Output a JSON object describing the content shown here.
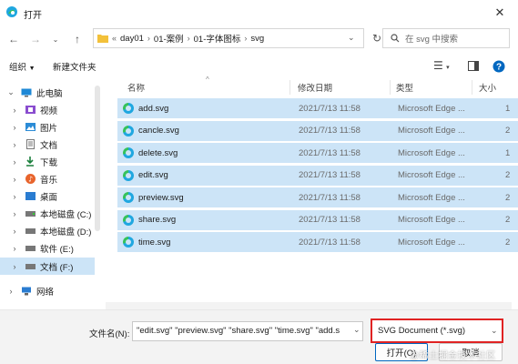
{
  "window": {
    "title": "打开"
  },
  "nav": {
    "breadcrumb": [
      "day01",
      "01-案例",
      "01-字体图标",
      "svg"
    ],
    "breadcrumb_prefix": "«",
    "search_placeholder": "在 svg 中搜索"
  },
  "toolbar": {
    "organize": "组织",
    "new_folder": "新建文件夹"
  },
  "sidebar": {
    "items": [
      {
        "label": "此电脑",
        "icon": "computer-icon",
        "expanded": true
      },
      {
        "label": "视频",
        "icon": "video-icon"
      },
      {
        "label": "图片",
        "icon": "picture-icon"
      },
      {
        "label": "文档",
        "icon": "document-icon"
      },
      {
        "label": "下载",
        "icon": "download-icon"
      },
      {
        "label": "音乐",
        "icon": "music-icon"
      },
      {
        "label": "桌面",
        "icon": "desktop-icon"
      },
      {
        "label": "本地磁盘 (C:)",
        "icon": "drive-icon"
      },
      {
        "label": "本地磁盘 (D:)",
        "icon": "drive-icon"
      },
      {
        "label": "软件 (E:)",
        "icon": "drive-icon"
      },
      {
        "label": "文档 (F:)",
        "icon": "drive-icon",
        "selected": true
      },
      {
        "label": "网络",
        "icon": "network-icon"
      }
    ]
  },
  "columns": {
    "name": "名称",
    "date": "修改日期",
    "type": "类型",
    "size": "大小"
  },
  "files": [
    {
      "name": "add.svg",
      "date": "2021/7/13 11:58",
      "type": "Microsoft Edge ...",
      "size": "1"
    },
    {
      "name": "cancle.svg",
      "date": "2021/7/13 11:58",
      "type": "Microsoft Edge ...",
      "size": "2"
    },
    {
      "name": "delete.svg",
      "date": "2021/7/13 11:58",
      "type": "Microsoft Edge ...",
      "size": "1"
    },
    {
      "name": "edit.svg",
      "date": "2021/7/13 11:58",
      "type": "Microsoft Edge ...",
      "size": "2"
    },
    {
      "name": "preview.svg",
      "date": "2021/7/13 11:58",
      "type": "Microsoft Edge ...",
      "size": "2"
    },
    {
      "name": "share.svg",
      "date": "2021/7/13 11:58",
      "type": "Microsoft Edge ...",
      "size": "2"
    },
    {
      "name": "time.svg",
      "date": "2021/7/13 11:58",
      "type": "Microsoft Edge ...",
      "size": "2"
    }
  ],
  "bottom": {
    "filename_label": "文件名(N):",
    "filename_value": "\"edit.svg\" \"preview.svg\" \"share.svg\" \"time.svg\" \"add.s",
    "filetype_value": "SVG Document (*.svg)",
    "open_button": "打开(O)",
    "cancel_button": "取消"
  },
  "watermark": "@稀土掘金技术社区",
  "colors": {
    "selection": "#cce4f7",
    "highlight_border": "#e02323",
    "accent": "#0067c0"
  }
}
